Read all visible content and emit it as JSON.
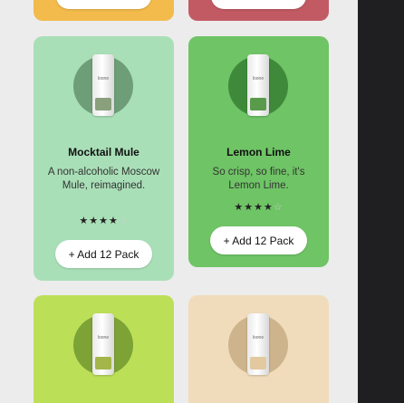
{
  "colors": {
    "card_orange": "#f2bb4c",
    "card_red": "#c25a64",
    "card_mint": "#a9dfb7",
    "card_green": "#6fc466",
    "card_lime": "#bcdf58",
    "card_beige": "#f0dcbb",
    "right_panel": "#1f1f21"
  },
  "products": [
    {
      "name": "Mocktail Mule",
      "description": "A non-alcoholic Moscow Mule, reimagined.",
      "rating": 4,
      "rating_max": 5,
      "button_label": "+ Add 12 Pack",
      "can_label": "loone"
    },
    {
      "name": "Lemon Lime",
      "description": "So crisp, so fine, it's Lemon Lime.",
      "rating": 4,
      "rating_max": 5,
      "button_label": "+ Add 12 Pack",
      "can_label": "loone"
    },
    {
      "can_label": "loone"
    },
    {
      "can_label": "loone"
    }
  ]
}
